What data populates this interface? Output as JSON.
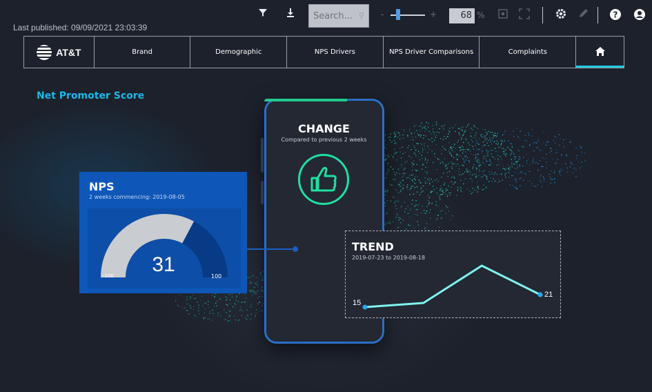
{
  "toolbar": {
    "filter_icon": "filter-icon",
    "download_icon": "download-icon",
    "search_placeholder": "Search...",
    "zoom_value": "68",
    "zoom_unit": "%",
    "zoom_minus": "-",
    "zoom_plus": "+",
    "icons": [
      "fit-page-icon",
      "fullscreen-icon",
      "gear-icon",
      "edit-icon",
      "help-icon",
      "user-icon"
    ]
  },
  "last_published": "Last published: 09/09/2021 23:03:39",
  "nav": {
    "logo_text": "AT&T",
    "items": [
      {
        "label": "Brand"
      },
      {
        "label": "Demographic"
      },
      {
        "label": "NPS Drivers"
      },
      {
        "label": "NPS Driver Comparisons"
      },
      {
        "label": "Complaints"
      }
    ],
    "home_icon": "home-icon"
  },
  "page_title": "Net Promoter Score",
  "change": {
    "title": "CHANGE",
    "subtitle": "Compared to previous 2 weeks",
    "icon": "thumbs-up-icon"
  },
  "nps": {
    "title": "NPS",
    "subtitle": "2 weeks commencing: 2019-08-05",
    "value": 31,
    "min_label": "-100",
    "max_label": "100",
    "min": -100,
    "max": 100
  },
  "trend": {
    "title": "TREND",
    "subtitle": "2019-07-23 to 2019-08-18",
    "start_label": "15",
    "end_label": "21"
  },
  "chart_data": {
    "type": "line",
    "title": "TREND",
    "series": [
      {
        "values": [
          15,
          17,
          35,
          21
        ]
      }
    ],
    "x": [
      0,
      1,
      2,
      3
    ],
    "ylim": [
      10,
      40
    ],
    "grid": false,
    "line_color": "#7ff3f0"
  },
  "colors": {
    "accent": "#1ab8e8",
    "nps_card": "#0e57b8",
    "thumb": "#1fe0a0",
    "trend_line": "#7ff3f0"
  }
}
